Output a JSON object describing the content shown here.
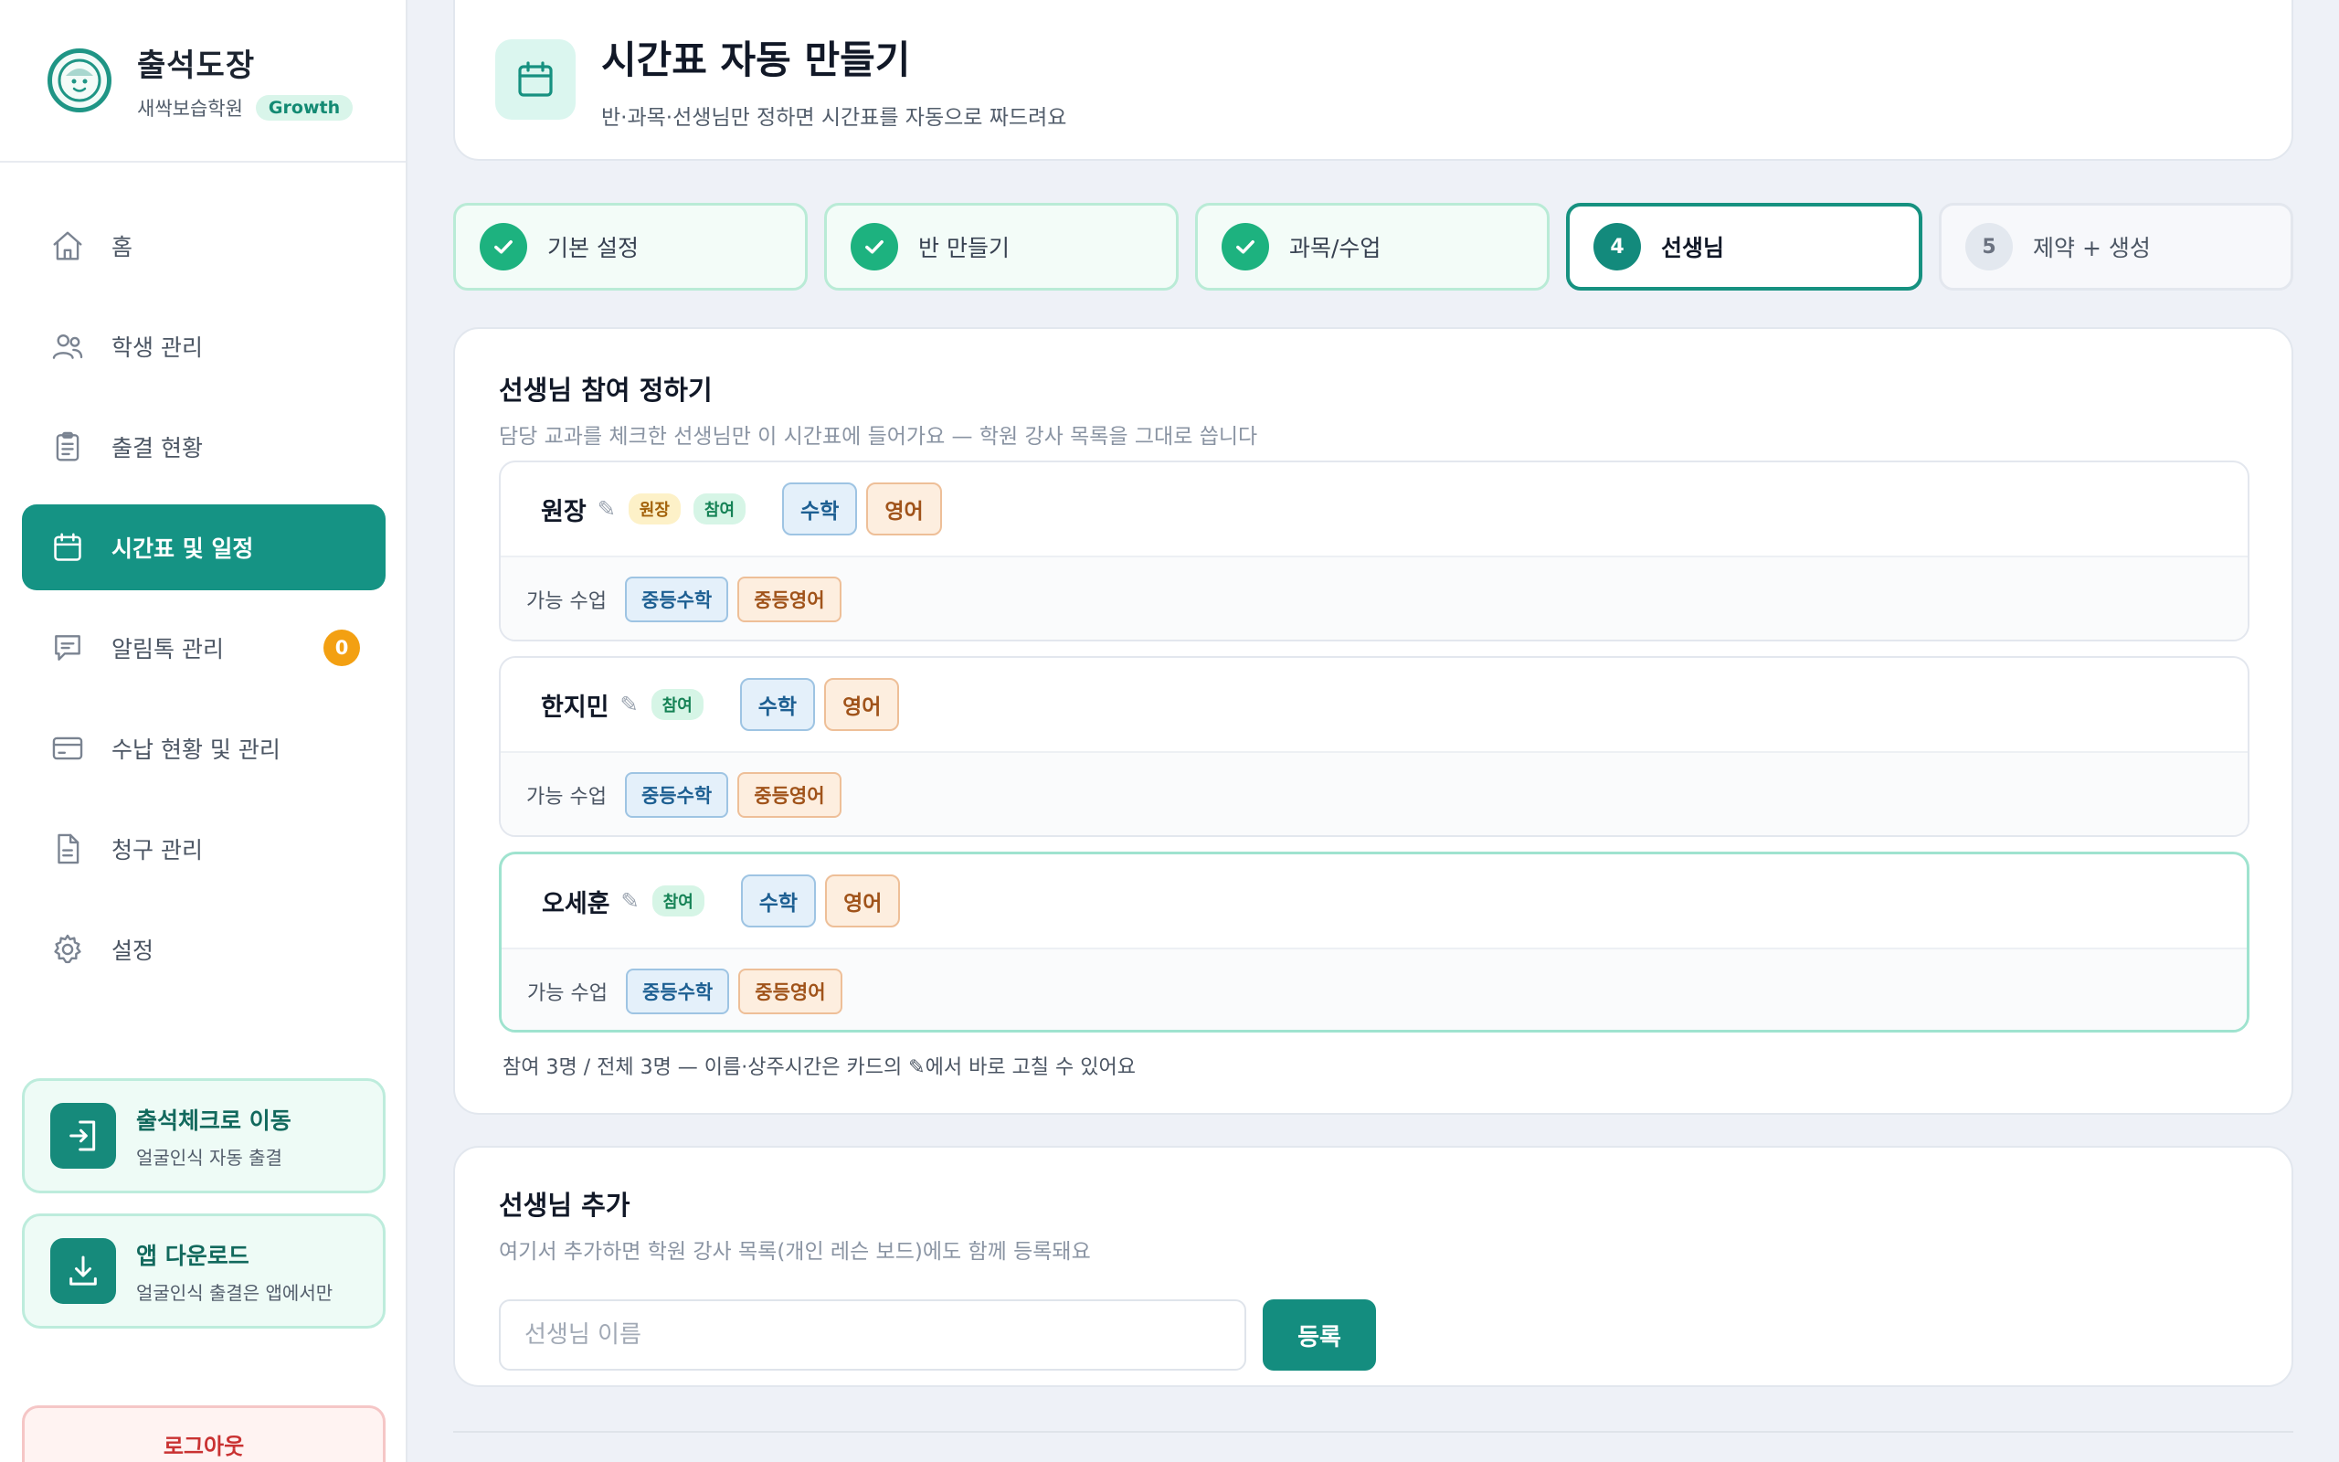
{
  "brand": {
    "name": "출석도장",
    "academy": "새싹보습학원",
    "plan": "Growth"
  },
  "nav": {
    "items": [
      {
        "label": "홈",
        "icon": "home-icon"
      },
      {
        "label": "학생 관리",
        "icon": "users-icon"
      },
      {
        "label": "출결 현황",
        "icon": "clipboard-icon"
      },
      {
        "label": "시간표 및 일정",
        "icon": "calendar-icon",
        "active": true
      },
      {
        "label": "알림톡 관리",
        "icon": "chat-icon",
        "badge": "0"
      },
      {
        "label": "수납 현황 및 관리",
        "icon": "card-icon"
      },
      {
        "label": "청구 관리",
        "icon": "document-icon"
      },
      {
        "label": "설정",
        "icon": "gear-icon"
      }
    ]
  },
  "promos": {
    "checkin": {
      "title": "출석체크로 이동",
      "sub": "얼굴인식 자동 출결"
    },
    "app": {
      "title": "앱 다운로드",
      "sub": "얼굴인식 출결은 앱에서만"
    }
  },
  "logout_label": "로그아웃",
  "header": {
    "title": "시간표 자동 만들기",
    "subtitle": "반·과목·선생님만 정하면 시간표를 자동으로 짜드려요"
  },
  "steps": [
    {
      "num": "✓",
      "label": "기본 설정",
      "state": "done"
    },
    {
      "num": "✓",
      "label": "반 만들기",
      "state": "done"
    },
    {
      "num": "✓",
      "label": "과목/수업",
      "state": "done"
    },
    {
      "num": "4",
      "label": "선생님",
      "state": "current"
    },
    {
      "num": "5",
      "label": "제약 + 생성",
      "state": "todo"
    }
  ],
  "teachers_section": {
    "title": "선생님 참여 정하기",
    "subtitle": "담당 교과를 체크한 선생님만 이 시간표에 들어가요 — 학원 강사 목록을 그대로 씁니다",
    "edit_icon": "✎",
    "available_label": "가능 수업",
    "teachers": [
      {
        "name": "원장",
        "badges": [
          "원장",
          "참여"
        ],
        "subjects": [
          "수학",
          "영어"
        ],
        "classes": [
          "중등수학",
          "중등영어"
        ]
      },
      {
        "name": "한지민",
        "badges": [
          "참여"
        ],
        "subjects": [
          "수학",
          "영어"
        ],
        "classes": [
          "중등수학",
          "중등영어"
        ]
      },
      {
        "name": "오세훈",
        "badges": [
          "참여"
        ],
        "subjects": [
          "수학",
          "영어"
        ],
        "classes": [
          "중등수학",
          "중등영어"
        ]
      }
    ],
    "summary": "참여 3명 / 전체 3명 — 이름·상주시간은 카드의 ✎에서 바로 고칠 수 있어요"
  },
  "add_section": {
    "title": "선생님 추가",
    "subtitle": "여기서 추가하면 학원 강사 목록(개인 레슨 보드)에도 함께 등록돼요",
    "placeholder": "선생님 이름",
    "button": "등록"
  },
  "colors": {
    "accent": "#159384",
    "done": "#1db27f",
    "badge": "#f3a012",
    "logout": "#c93232"
  }
}
